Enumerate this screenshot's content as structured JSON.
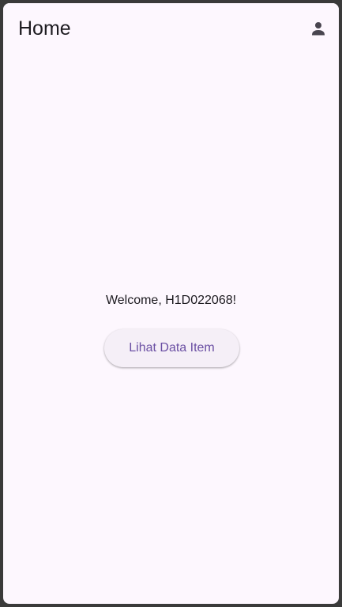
{
  "app_bar": {
    "title": "Home",
    "profile_icon": "person-icon"
  },
  "main": {
    "welcome_text": "Welcome, H1D022068!",
    "view_items_button_label": "Lihat Data Item"
  },
  "colors": {
    "background": "#fdf7fe",
    "title_text": "#1d1b20",
    "icon": "#49454f",
    "button_background": "#f5eff7",
    "button_text": "#6a4fa3"
  }
}
